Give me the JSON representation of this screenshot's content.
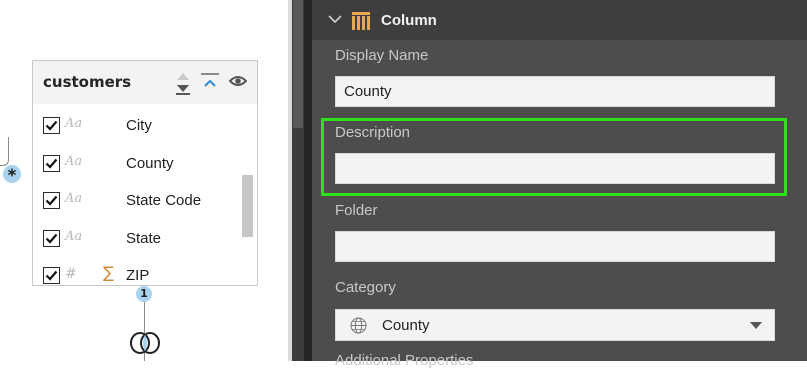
{
  "diagram": {
    "relationship_many_symbol": "*",
    "relationship_one_symbol": "1",
    "table": {
      "title": "customers",
      "fields": [
        {
          "type_icon": "Aa",
          "name": "City",
          "checked": true,
          "summarize": false
        },
        {
          "type_icon": "Aa",
          "name": "County",
          "checked": true,
          "summarize": false
        },
        {
          "type_icon": "Aa",
          "name": "State Code",
          "checked": true,
          "summarize": false
        },
        {
          "type_icon": "Aa",
          "name": "State",
          "checked": true,
          "summarize": false
        },
        {
          "type_icon": "#",
          "name": "ZIP",
          "checked": true,
          "summarize": true,
          "summarize_symbol": "∑"
        }
      ]
    }
  },
  "properties": {
    "section_title": "Column",
    "display_name": {
      "label": "Display Name",
      "value": "County"
    },
    "description": {
      "label": "Description",
      "value": ""
    },
    "folder": {
      "label": "Folder",
      "value": ""
    },
    "category": {
      "label": "Category",
      "value": "County"
    },
    "next_section_label": "Additional Properties"
  },
  "colors": {
    "panel_bg": "#4d4d4d",
    "highlight": "#2ee21b",
    "badge": "#a9d2ef",
    "column_icon": "#e8a857"
  }
}
